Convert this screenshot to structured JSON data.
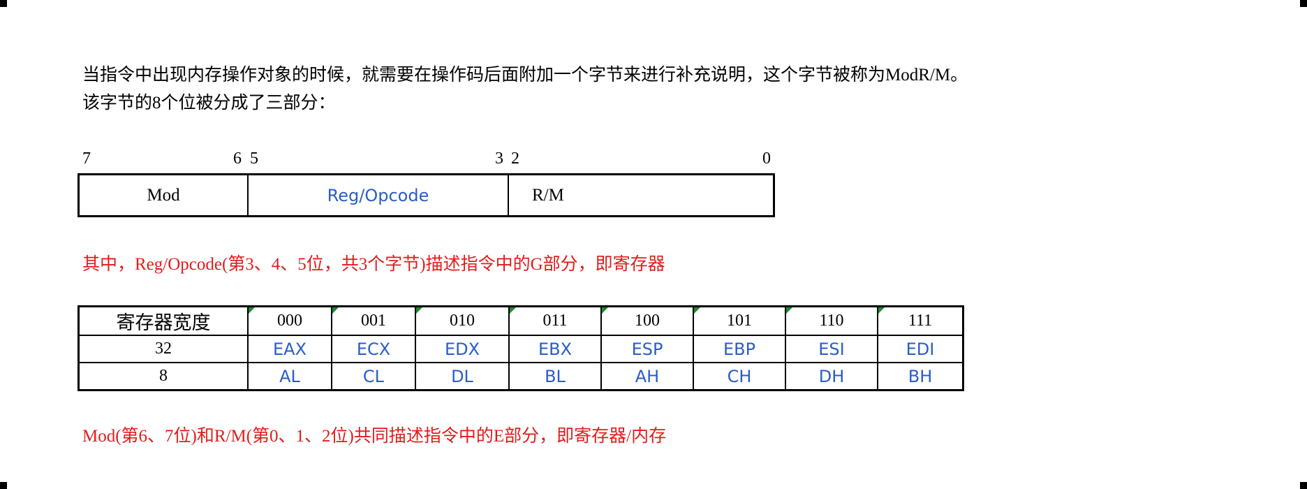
{
  "intro": {
    "line1": "当指令中出现内存操作对象的时候，就需要在操作码后面附加一个字节来进行补充说明，这个字节被称为ModR/M。",
    "line2": "该字节的8个位被分成了三部分："
  },
  "bit_labels": [
    "7",
    "6",
    "5",
    "3",
    "2",
    "0"
  ],
  "modrm_fields": [
    "Mod",
    "Reg/Opcode",
    "R/M"
  ],
  "note1": "其中，Reg/Opcode(第3、4、5位，共3个字节)描述指令中的G部分，即寄存器",
  "note2": "Mod(第6、7位)和R/M(第0、1、2位)共同描述指令中的E部分，即寄存器/内存",
  "register_table": {
    "header": [
      "寄存器宽度",
      "000",
      "001",
      "010",
      "011",
      "100",
      "101",
      "110",
      "111"
    ],
    "rows": [
      [
        "32",
        "EAX",
        "ECX",
        "EDX",
        "EBX",
        "ESP",
        "EBP",
        "ESI",
        "EDI"
      ],
      [
        "8",
        "AL",
        "CL",
        "DL",
        "BL",
        "AH",
        "CH",
        "DH",
        "BH"
      ]
    ]
  },
  "colors": {
    "note_red": "#e31b1b",
    "register_blue": "#2a5cc9",
    "cell_flag_green": "#1e8c2a"
  }
}
